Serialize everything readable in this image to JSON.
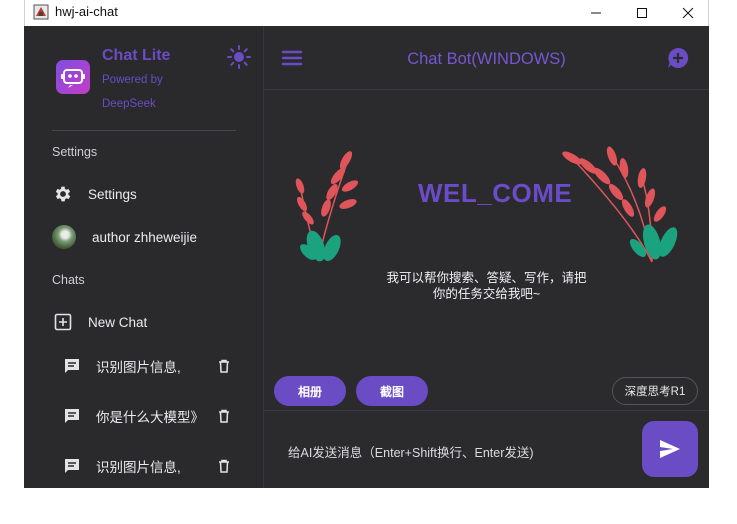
{
  "window": {
    "title": "hwj-ai-chat"
  },
  "sidebar": {
    "brand_name": "Chat Lite",
    "brand_sub_line1": "Powered by",
    "brand_sub_line2": "DeepSeek",
    "settings_section": "Settings",
    "settings_item": "Settings",
    "author_item": "author zhheweijie",
    "chats_section": "Chats",
    "new_chat": "New Chat",
    "chats": [
      {
        "label": "识别图片信息,"
      },
      {
        "label": "你是什么大模型》"
      },
      {
        "label": "识别图片信息,"
      }
    ]
  },
  "main": {
    "title": "Chat Bot(WINDOWS)",
    "welcome": "WEL_COME",
    "intro_line1": "我可以帮你搜索、答疑、写作，请把",
    "intro_line2": "你的任务交给我吧~",
    "album_button": "相册",
    "screenshot_button": "截图",
    "deep_think_button": "深度思考R1",
    "input_placeholder": "给AI发送消息（Enter+Shift换行、Enter发送)"
  },
  "icons": {
    "theme": "sun-icon",
    "menu": "hamburger-icon",
    "new_chat": "chat-plus-icon",
    "send": "send-icon",
    "delete": "trash-icon",
    "settings": "gear-icon",
    "chat": "message-icon"
  },
  "colors": {
    "accent": "#6a4cc4",
    "background": "#2b2b2e",
    "sidebar": "#2a2a2d",
    "text": "#ececef",
    "plant_red": "#e0555a",
    "plant_green": "#1aa37e"
  }
}
